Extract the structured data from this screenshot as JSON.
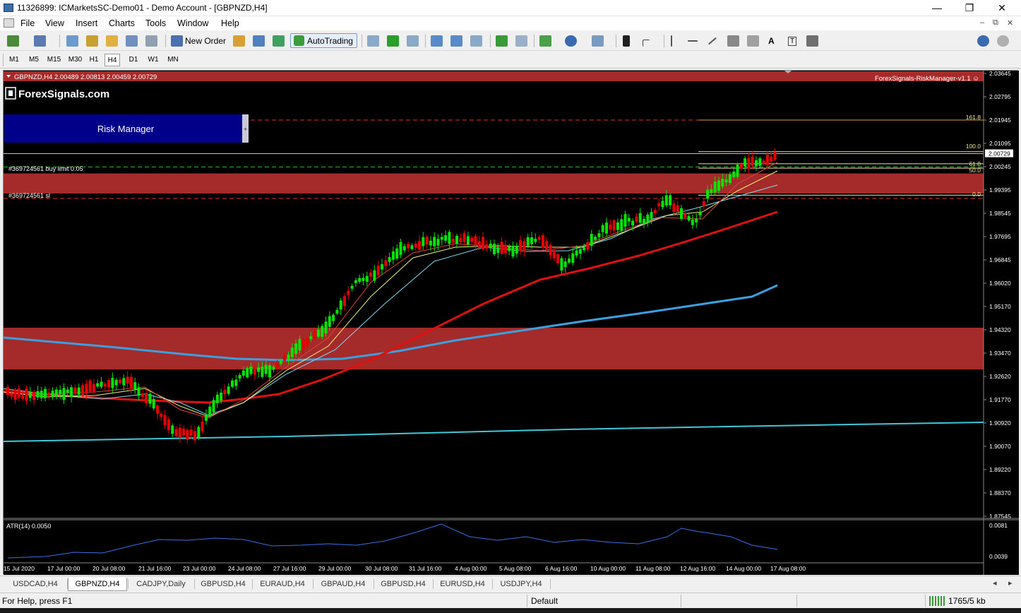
{
  "window": {
    "title": "11326899: ICMarketsSC-Demo01 - Demo Account - [GBPNZD,H4]",
    "minimize": "—",
    "maximize": "❐",
    "close": "✕"
  },
  "menu": {
    "items": [
      "File",
      "View",
      "Insert",
      "Charts",
      "Tools",
      "Window",
      "Help"
    ],
    "mdi_min": "–",
    "mdi_restore": "⧉",
    "mdi_close": "✕"
  },
  "toolbar": {
    "new_order": "New Order",
    "autotrading": "AutoTrading",
    "text_tool": "A",
    "text_label_tool": "T"
  },
  "timeframes": {
    "items": [
      "M1",
      "M5",
      "M15",
      "M30",
      "H1",
      "H4",
      "D1",
      "W1",
      "MN"
    ],
    "active": "H4"
  },
  "chart": {
    "header": "GBPNZD,H4  2.00489 2.00813 2.00459 2.00729",
    "ea_label": "ForexSignals-RiskManager-v1.1 ☺",
    "logo": "ForexSignals.com",
    "risk_manager_button": "Risk Manager",
    "risk_manager_handle": "+",
    "order_buy_limit": "#369724561 buy limit 0.05",
    "order_sl": "#369724561 sl",
    "current_price": "2.00729",
    "fib_levels": [
      "161.8",
      "100.0",
      "61.8",
      "50.0",
      "0.0"
    ],
    "price_axis": [
      "2.03645",
      "2.02795",
      "2.01945",
      "2.01095",
      "2.00245",
      "1.99395",
      "1.98545",
      "1.97695",
      "1.96845",
      "1.96020",
      "1.95170",
      "1.94320",
      "1.93470",
      "1.92620",
      "1.91770",
      "1.90920",
      "1.90070",
      "1.89220",
      "1.88370",
      "1.87545"
    ],
    "time_axis": [
      "15 Jul 2020",
      "17 Jul 00:00",
      "20 Jul 08:00",
      "21 Jul 16:00",
      "23 Jul 00:00",
      "24 Jul 08:00",
      "27 Jul 16:00",
      "29 Jul 00:00",
      "30 Jul 08:00",
      "31 Jul 16:00",
      "4 Aug 00:00",
      "5 Aug 08:00",
      "6 Aug 16:00",
      "10 Aug 00:00",
      "11 Aug 08:00",
      "12 Aug 16:00",
      "14 Aug 00:00",
      "17 Aug 08:00"
    ],
    "atr_label": "ATR(14) 0.0050",
    "atr_axis": [
      "0.0081",
      "0.0039"
    ],
    "colors": {
      "bull": "#00e600",
      "bear": "#e60000",
      "zone": "#a52a2a",
      "ma_red": "#e01010",
      "ma_blue": "#3aa0e0",
      "ma_cyan": "#40c8d8",
      "atr": "#3a6ee8"
    }
  },
  "tabs": {
    "items": [
      "USDCAD,H4",
      "GBPNZD,H4",
      "CADJPY,Daily",
      "GBPUSD,H4",
      "EURAUD,H4",
      "GBPAUD,H4",
      "GBPUSD,H4",
      "EURUSD,H4",
      "USDJPY,H4"
    ],
    "active": "GBPNZD,H4",
    "scroll_left": "◂",
    "scroll_right": "▸"
  },
  "status": {
    "help": "For Help, press F1",
    "profile": "Default",
    "traffic": "1765/5 kb"
  }
}
